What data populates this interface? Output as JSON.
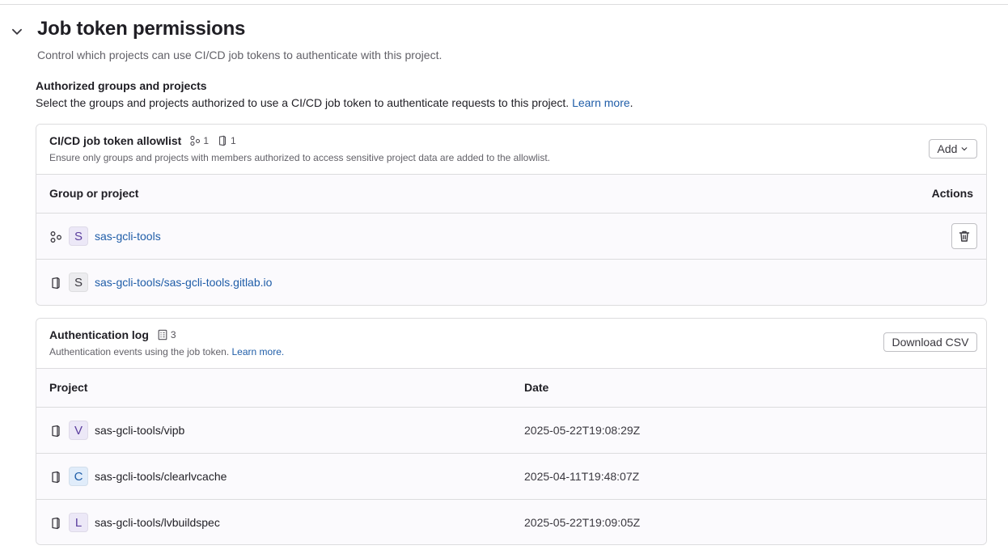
{
  "section": {
    "title": "Job token permissions",
    "description": "Control which projects can use CI/CD job tokens to authenticate with this project.",
    "authorized_heading": "Authorized groups and projects",
    "authorized_description": "Select the groups and projects authorized to use a CI/CD job token to authenticate requests to this project.",
    "learn_more": "Learn more",
    "period": "."
  },
  "allowlist": {
    "title": "CI/CD job token allowlist",
    "group_count": "1",
    "project_count": "1",
    "subtitle": "Ensure only groups and projects with members authorized to access sensitive project data are added to the allowlist.",
    "add_label": "Add",
    "col_group": "Group or project",
    "col_actions": "Actions",
    "rows": [
      {
        "initial": "S",
        "name": "sas-gcli-tools",
        "type_icon": "group-icon",
        "avatar_color": "#ece8f7",
        "avatar_text": "#5b3e9e"
      },
      {
        "initial": "S",
        "name": "sas-gcli-tools/sas-gcli-tools.gitlab.io",
        "type_icon": "project-icon",
        "avatar_color": "#ececef",
        "avatar_text": "#3a383f"
      }
    ]
  },
  "auth_log": {
    "title": "Authentication log",
    "count": "3",
    "subtitle": "Authentication events using the job token.",
    "learn_more": "Learn more.",
    "csv_label": "Download CSV",
    "col_project": "Project",
    "col_date": "Date",
    "rows": [
      {
        "initial": "V",
        "name": "sas-gcli-tools/vipb",
        "date": "2025-05-22T19:08:29Z",
        "avatar_color": "#ece8f7",
        "avatar_text": "#5b3e9e"
      },
      {
        "initial": "C",
        "name": "sas-gcli-tools/clearlvcache",
        "date": "2025-04-11T19:48:07Z",
        "avatar_color": "#e0ecfa",
        "avatar_text": "#1f5da8"
      },
      {
        "initial": "L",
        "name": "sas-gcli-tools/lvbuildspec",
        "date": "2025-05-22T19:09:05Z",
        "avatar_color": "#ece8f7",
        "avatar_text": "#5b3e9e"
      }
    ]
  }
}
